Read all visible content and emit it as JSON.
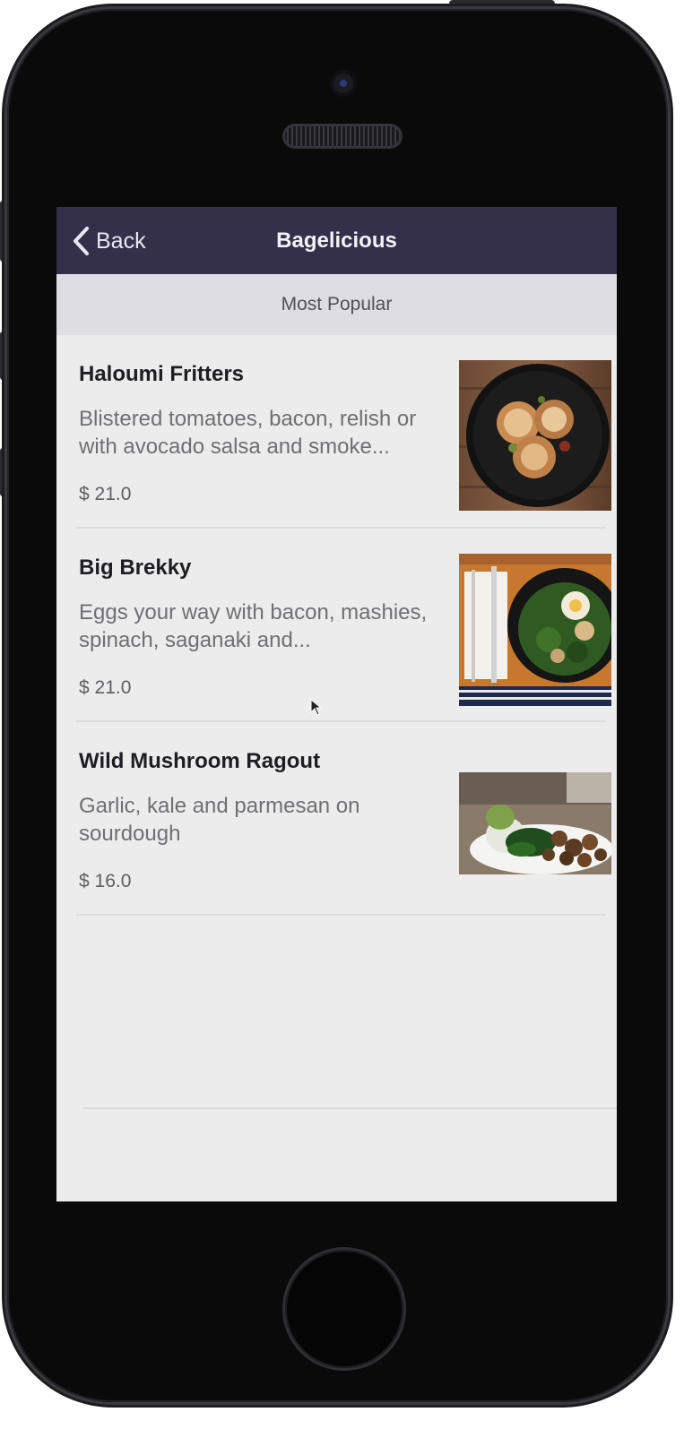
{
  "navbar": {
    "back_label": "Back",
    "title": "Bagelicious"
  },
  "section": {
    "header": "Most Popular"
  },
  "menu_items": [
    {
      "name": "Haloumi Fritters",
      "description": "Blistered tomatoes, bacon, relish or with avocado salsa and smoke...",
      "price": "$ 21.0",
      "image": "haloumi-fritters-photo"
    },
    {
      "name": "Big Brekky",
      "description": "Eggs your way with bacon, mashies, spinach, saganaki and...",
      "price": "$ 21.0",
      "image": "big-brekky-photo"
    },
    {
      "name": "Wild Mushroom Ragout",
      "description": "Garlic, kale and parmesan on sourdough",
      "price": "$ 16.0",
      "image": "wild-mushroom-ragout-photo"
    }
  ],
  "colors": {
    "navbar_bg": "#34304a",
    "section_header_bg": "#dedde3",
    "screen_bg": "#ececec"
  }
}
